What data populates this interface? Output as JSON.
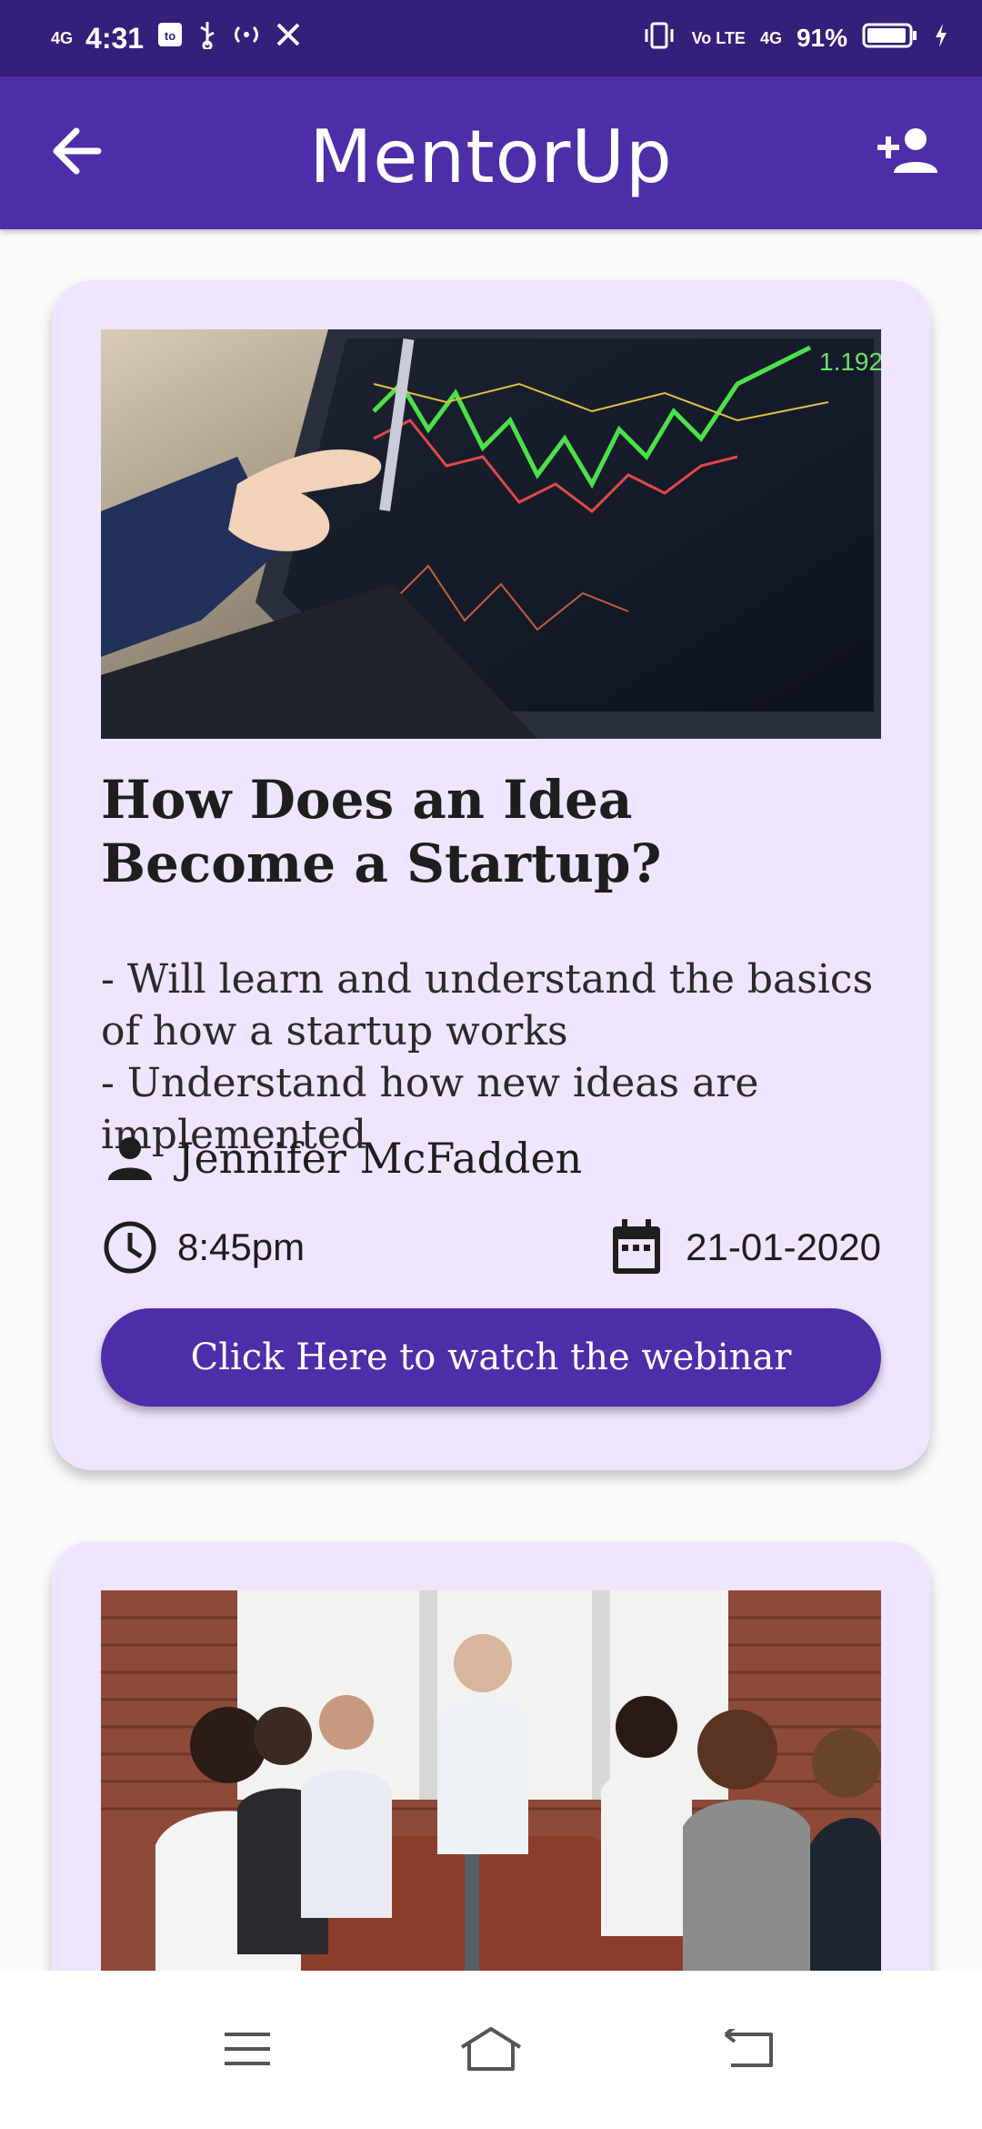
{
  "status_bar": {
    "network_left": "4G",
    "time": "4:31",
    "volte": "Vo LTE",
    "network_right": "4G",
    "battery": "91%"
  },
  "app_bar": {
    "title": "MentorUp",
    "back_icon": "arrow-back-icon",
    "add_icon": "person-add-icon"
  },
  "webinars": [
    {
      "title": "How Does an Idea Become a Startup?",
      "description": "- Will learn and understand the basics of how a startup works\n- Understand how new ideas are implemented",
      "mentor": "Jennifer McFadden",
      "time": "8:45pm",
      "date": "21-01-2020",
      "button_label": "Click Here to watch the webinar",
      "image": "laptop-stock-chart-photo"
    },
    {
      "image": "team-meeting-photo"
    }
  ],
  "nav_bar": {
    "menu_icon": "menu-icon",
    "home_icon": "home-icon",
    "back_icon": "back-icon"
  },
  "colors": {
    "status_bar": "#341F7A",
    "primary": "#4E2DA8",
    "card_bg": "#EEE6FE",
    "page_bg": "#FAFAFA"
  }
}
